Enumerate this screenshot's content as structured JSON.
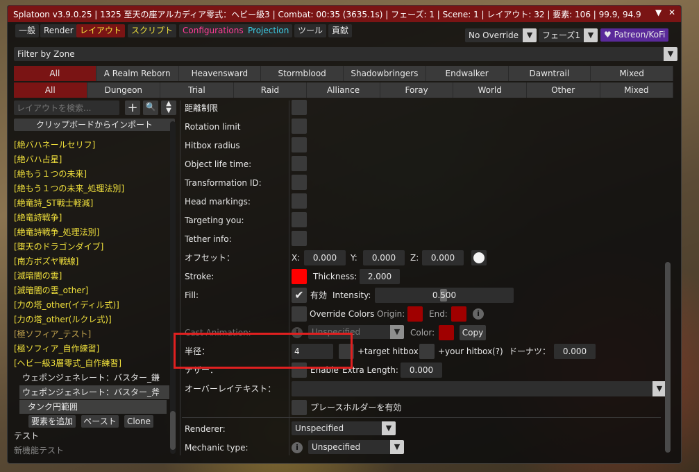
{
  "title": "Splatoon v3.9.0.25 | 1325 至天の座アルカディア零式：ヘビー級3 | Combat: 00:35 (3635.1s) | フェーズ: 1 | Scene: 1 | レイアウト: 32 | 要素: 106 | 99.9, 94.9",
  "title_controls": {
    "collapse": "▼",
    "close": "✕"
  },
  "tabs": [
    {
      "label": "一般",
      "color": "#ffffff"
    },
    {
      "label": "Render",
      "color": "#ffffff"
    },
    {
      "label": "レイアウト",
      "color": "#f0e03c"
    },
    {
      "label": "スクリプト",
      "color": "#f0e03c"
    },
    {
      "label": "Configurations",
      "color": "#ff3c96"
    },
    {
      "label": "Projection",
      "color": "#3cd0e8"
    },
    {
      "label": "ツール",
      "color": "#ffffff"
    },
    {
      "label": "貢献",
      "color": "#ffffff"
    }
  ],
  "override": {
    "value": "No Override"
  },
  "phase": {
    "value": "フェーズ1"
  },
  "patreon": {
    "label": "♥ Patreon/KoFi"
  },
  "filter": {
    "value": "Filter by Zone"
  },
  "expansions": [
    "All",
    "A Realm Reborn",
    "Heavensward",
    "Stormblood",
    "Shadowbringers",
    "Endwalker",
    "Dawntrail",
    "Mixed"
  ],
  "categories": [
    "All",
    "Dungeon",
    "Trial",
    "Raid",
    "Alliance",
    "Foray",
    "World",
    "Other",
    "Mixed"
  ],
  "search": {
    "placeholder": "レイアウトを検索..."
  },
  "import_label": "クリップボードからインポート",
  "layouts": [
    "[絶バハネールセリフ]",
    "[絶バハ占星]",
    "[絶もう１つの未来]",
    "[絶もう１つの未来_処理法別]",
    "[絶竜詩_ST戦士軽減]",
    "[絶竜詩戦争]",
    "[絶竜詩戦争_処理法別]",
    "[堕天のドラゴンダイブ]",
    "[南方ボズヤ戦線]",
    "[滅暗闇の雲]",
    "[滅暗闇の雲_other]",
    "[力の塔_other(イディル式)]",
    "[力の塔_other(ルクレ式)]",
    "[極ソフィア_テスト]",
    "[極ソフィア_自作練習]",
    "[ヘビー級3層零式_自作練習]"
  ],
  "subitems": [
    "ウェポンジェネレート：バスター_鎌",
    "ウェポンジェネレート：バスター_斧",
    "タンク円範囲"
  ],
  "left_buttons": {
    "add": "要素を追加",
    "paste": "ペースト",
    "clone": "Clone"
  },
  "bottom_items": [
    "テスト",
    "新機能テスト"
  ],
  "props": {
    "distance_limit": "距離制限",
    "rotation_limit": "Rotation limit",
    "hitbox_radius": "Hitbox radius",
    "object_life": "Object life time:",
    "transformation": "Transformation ID:",
    "head_markings": "Head markings:",
    "targeting": "Targeting you:",
    "tether": "Tether info:",
    "offset": "オフセット：",
    "stroke": "Stroke:",
    "fill": "Fill:",
    "cast_animation": "Cast Animation:",
    "radius": "半径：",
    "tether2": "テザー：",
    "overlay_text": "オーバーレイテキスト：",
    "renderer": "Renderer:",
    "mechanic_type": "Mechanic type:"
  },
  "offset": {
    "x_label": "X:",
    "x": "0.000",
    "y_label": "Y:",
    "y": "0.000",
    "z_label": "Z:",
    "z": "0.000"
  },
  "thickness": {
    "label": "Thickness:",
    "value": "2.000"
  },
  "fill": {
    "enabled_label": "有効",
    "intensity_label": "Intensity:",
    "intensity": "0.500"
  },
  "override_colors": {
    "label": "Override Colors",
    "origin": "Origin:",
    "end": "End:"
  },
  "cast": {
    "value": "Unspecified",
    "color_label": "Color:",
    "copy": "Copy"
  },
  "radius": {
    "value": "4",
    "target_hitbox": "+target hitbox",
    "your_hitbox": "+your hitbox",
    "help": "(?)",
    "donut_label": "ドーナツ：",
    "donut": "0.000"
  },
  "tether_opts": {
    "enable": "Enable",
    "extra_length_label": "Extra Length:",
    "extra_length": "0.000"
  },
  "placeholder_label": "プレースホルダーを有効",
  "renderer": {
    "value": "Unspecified"
  },
  "mechanic": {
    "value": "Unspecified"
  },
  "colors": {
    "titlebar": "#7a1414",
    "stroke": "#ff0000",
    "origin": "#a00000",
    "end": "#a00000",
    "cast": "#a00000"
  }
}
